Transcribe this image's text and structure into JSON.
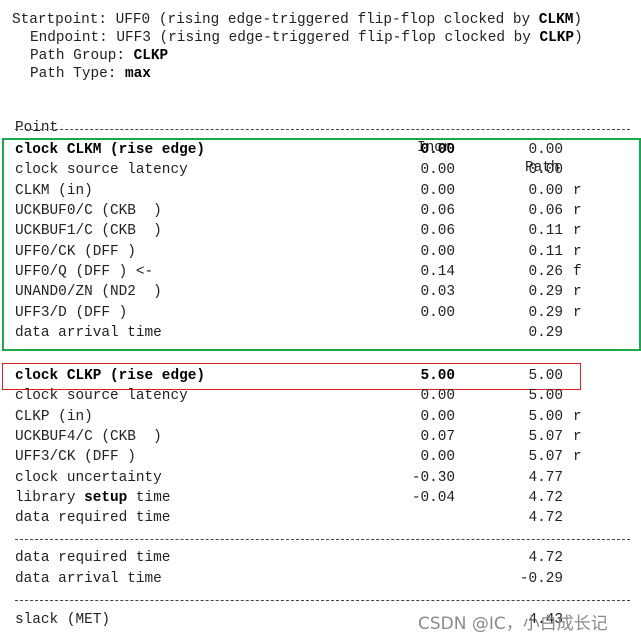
{
  "header": {
    "startpoint": {
      "label": "Startpoint: ",
      "value": "UFF0 (rising edge-triggered flip-flop clocked by ",
      "clock": "CLKM",
      "close": ")"
    },
    "endpoint": {
      "label": "Endpoint: ",
      "value": "UFF3 (rising edge-triggered flip-flop clocked by ",
      "clock": "CLKP",
      "close": ")"
    },
    "path_group": {
      "label": "Path Group: ",
      "value": "CLKP"
    },
    "path_type": {
      "label": "Path Type: ",
      "value": "max"
    }
  },
  "columns": {
    "point": "Point",
    "incr": "Incr",
    "path": "Path"
  },
  "launch_rows": [
    {
      "point": "clock CLKM (rise edge)",
      "incr": "0.00",
      "path": "0.00",
      "flag": ""
    },
    {
      "point": "clock source latency",
      "incr": "0.00",
      "path": "0.00",
      "flag": ""
    },
    {
      "point": "CLKM (in)",
      "incr": "0.00",
      "path": "0.00",
      "flag": "r"
    },
    {
      "point": "UCKBUF0/C (CKB  )",
      "incr": "0.06",
      "path": "0.06",
      "flag": "r"
    },
    {
      "point": "UCKBUF1/C (CKB  )",
      "incr": "0.06",
      "path": "0.11",
      "flag": "r"
    },
    {
      "point": "UFF0/CK (DFF )",
      "incr": "0.00",
      "path": "0.11",
      "flag": "r"
    },
    {
      "point": "UFF0/Q (DFF ) <-",
      "incr": "0.14",
      "path": "0.26",
      "flag": "f"
    },
    {
      "point": "UNAND0/ZN (ND2  )",
      "incr": "0.03",
      "path": "0.29",
      "flag": "r"
    },
    {
      "point": "UFF3/D (DFF )",
      "incr": "0.00",
      "path": "0.29",
      "flag": "r"
    },
    {
      "point": "data arrival time",
      "incr": "",
      "path": "0.29",
      "flag": ""
    }
  ],
  "capture_rows": [
    {
      "point": "clock CLKP (rise edge)",
      "incr": "5.00",
      "path": "5.00",
      "flag": ""
    },
    {
      "point": "clock source latency",
      "incr": "0.00",
      "path": "5.00",
      "flag": ""
    },
    {
      "point": "CLKP (in)",
      "incr": "0.00",
      "path": "5.00",
      "flag": "r"
    },
    {
      "point": "UCKBUF4/C (CKB  )",
      "incr": "0.07",
      "path": "5.07",
      "flag": "r"
    },
    {
      "point": "UFF3/CK (DFF )",
      "incr": "0.00",
      "path": "5.07",
      "flag": "r"
    },
    {
      "point": "clock uncertainty",
      "incr": "-0.30",
      "path": "4.77",
      "flag": ""
    },
    {
      "point_pre": "library ",
      "point_bold": "setup",
      "point_post": " time",
      "incr": "-0.04",
      "path": "4.72",
      "flag": ""
    },
    {
      "point": "data required time",
      "incr": "",
      "path": "4.72",
      "flag": ""
    }
  ],
  "summary_rows": [
    {
      "point": "data required time",
      "path": "4.72"
    },
    {
      "point": "data arrival time",
      "path": "-0.29"
    }
  ],
  "slack": {
    "point": "slack (MET)",
    "path": "4.43"
  },
  "highlight_colors": {
    "launch_box": "#1aa84a",
    "capture_box": "#e02020"
  },
  "watermark": "CSDN @IC，小白成长记"
}
